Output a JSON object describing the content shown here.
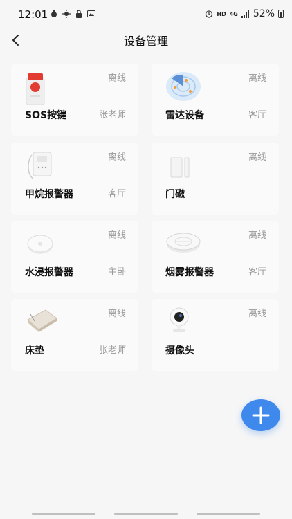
{
  "status_bar": {
    "time": "12:01",
    "network_label": "HD",
    "signal_label": "4G",
    "battery": "52%"
  },
  "header": {
    "title": "设备管理",
    "back_icon": "chevron-left-icon"
  },
  "devices": [
    {
      "name": "SOS按键",
      "status": "离线",
      "room": "张老师",
      "icon": "sos-button-icon"
    },
    {
      "name": "雷达设备",
      "status": "离线",
      "room": "客厅",
      "icon": "radar-icon"
    },
    {
      "name": "甲烷报警器",
      "status": "离线",
      "room": "客厅",
      "icon": "methane-alarm-icon"
    },
    {
      "name": "门磁",
      "status": "离线",
      "room": "",
      "icon": "door-sensor-icon"
    },
    {
      "name": "水浸报警器",
      "status": "离线",
      "room": "主卧",
      "icon": "water-leak-sensor-icon"
    },
    {
      "name": "烟雾报警器",
      "status": "离线",
      "room": "客厅",
      "icon": "smoke-detector-icon"
    },
    {
      "name": "床垫",
      "status": "离线",
      "room": "张老师",
      "icon": "mattress-icon"
    },
    {
      "name": "摄像头",
      "status": "离线",
      "room": "",
      "icon": "camera-icon"
    }
  ],
  "fab": {
    "icon": "plus-icon",
    "color": "#3f89ec"
  },
  "colors": {
    "background": "#f6f6f6",
    "card": "#fafafa",
    "muted_text": "#999999",
    "accent": "#3f89ec"
  }
}
